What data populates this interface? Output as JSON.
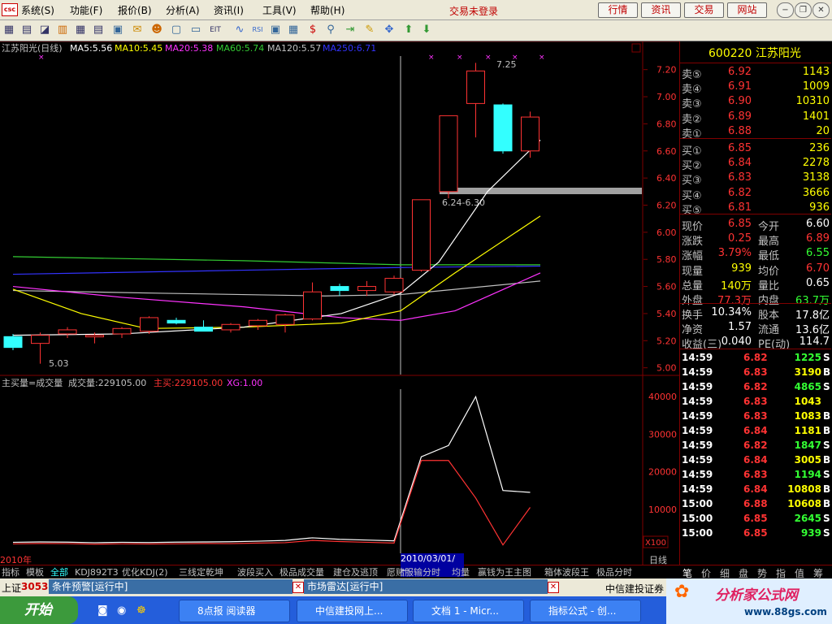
{
  "menubar": {
    "logo": "csc",
    "items": [
      "系统(S)",
      "功能(F)",
      "报价(B)",
      "分析(A)",
      "资讯(I)",
      "工具(V)",
      "帮助(H)"
    ],
    "login_status": "交易未登录",
    "buttons": [
      "行情",
      "资讯",
      "交易",
      "网站"
    ]
  },
  "chart": {
    "title_line": {
      "name": "江苏阳光(日线)",
      "ma5": "MA5:5.56",
      "ma10": "MA10:5.45",
      "ma20": "MA20:5.38",
      "ma60": "MA60:5.74",
      "ma120": "MA120:5.57",
      "ma250": "MA250:6.71"
    },
    "price_axis": [
      "7.20",
      "7.00",
      "6.80",
      "6.60",
      "6.40",
      "6.20",
      "6.00",
      "5.80",
      "5.60",
      "5.40",
      "5.20",
      "5.00"
    ],
    "annotations": {
      "high": "7.25",
      "low": "5.03",
      "gap": "6.24-6.30"
    },
    "volume_title": {
      "formula": "主买量=成交量",
      "volume": "成交量:229105.00",
      "buy": "主买:229105.00",
      "xg": "XG:1.00"
    },
    "volume_axis": [
      "40000",
      "30000",
      "20000",
      "10000"
    ],
    "volume_unit": "X100",
    "year_label": "2010年",
    "cursor_date": "2010/03/01/一",
    "period_label": "日线"
  },
  "chart_data": {
    "type": "candlestick",
    "x": [
      "c1",
      "c2",
      "c3",
      "c4",
      "c5",
      "c6",
      "c7",
      "c8",
      "c9",
      "c10",
      "c11",
      "c12",
      "c13",
      "c14",
      "c15",
      "c16",
      "c17",
      "c18",
      "c19",
      "c20"
    ],
    "ohlc": [
      [
        5.23,
        5.25,
        5.13,
        5.15
      ],
      [
        5.18,
        5.26,
        5.03,
        5.24
      ],
      [
        5.25,
        5.3,
        5.22,
        5.28
      ],
      [
        5.23,
        5.26,
        5.18,
        5.24
      ],
      [
        5.25,
        5.3,
        5.22,
        5.29
      ],
      [
        5.27,
        5.38,
        5.25,
        5.37
      ],
      [
        5.35,
        5.37,
        5.32,
        5.33
      ],
      [
        5.3,
        5.35,
        5.27,
        5.27
      ],
      [
        5.28,
        5.33,
        5.26,
        5.32
      ],
      [
        5.31,
        5.36,
        5.28,
        5.35
      ],
      [
        5.32,
        5.4,
        5.26,
        5.39
      ],
      [
        5.36,
        5.63,
        5.35,
        5.56
      ],
      [
        5.6,
        5.62,
        5.53,
        5.57
      ],
      [
        5.57,
        5.64,
        5.53,
        5.6
      ],
      [
        5.56,
        5.68,
        5.54,
        5.66
      ],
      [
        5.72,
        6.24,
        5.71,
        6.24
      ],
      [
        6.3,
        6.86,
        6.25,
        6.86
      ],
      [
        6.95,
        7.25,
        6.7,
        7.19
      ],
      [
        6.94,
        6.95,
        6.58,
        6.6
      ],
      [
        6.6,
        6.89,
        6.55,
        6.85
      ]
    ],
    "volume_main": [
      1200,
      1300,
      1250,
      1100,
      1200,
      1150,
      1250,
      1300,
      1350,
      1500,
      1700,
      2400,
      2000,
      1800,
      1600,
      24000,
      27000,
      40000,
      15000,
      14500
    ],
    "volume_buy": [
      800,
      900,
      850,
      700,
      800,
      750,
      800,
      900,
      850,
      1000,
      1100,
      1700,
      1400,
      1200,
      1000,
      23000,
      23000,
      13000,
      500,
      10500
    ],
    "ylim": [
      4.98,
      7.3
    ],
    "volume_ylim": [
      0,
      42000
    ],
    "ma_colors": {
      "ma5": "#ffffff",
      "ma10": "#ffff00",
      "ma20": "#ff33ff",
      "ma60": "#33cc33",
      "ma120": "#c0c0c0",
      "ma250": "#3333ff"
    }
  },
  "quote": {
    "code": "600220",
    "name": "江苏阳光",
    "asks": [
      {
        "label": "卖⑤",
        "price": "6.92",
        "vol": "1143"
      },
      {
        "label": "卖④",
        "price": "6.91",
        "vol": "1009"
      },
      {
        "label": "卖③",
        "price": "6.90",
        "vol": "10310"
      },
      {
        "label": "卖②",
        "price": "6.89",
        "vol": "1401"
      },
      {
        "label": "卖①",
        "price": "6.88",
        "vol": "20"
      }
    ],
    "bids": [
      {
        "label": "买①",
        "price": "6.85",
        "vol": "236"
      },
      {
        "label": "买②",
        "price": "6.84",
        "vol": "2278"
      },
      {
        "label": "买③",
        "price": "6.83",
        "vol": "3138"
      },
      {
        "label": "买④",
        "price": "6.82",
        "vol": "3666"
      },
      {
        "label": "买⑤",
        "price": "6.81",
        "vol": "936"
      }
    ],
    "stats1": [
      {
        "l1": "现价",
        "v1": "6.85",
        "c1": "red",
        "l2": "今开",
        "v2": "6.60",
        "c2": "white"
      },
      {
        "l1": "涨跌",
        "v1": "0.25",
        "c1": "red",
        "l2": "最高",
        "v2": "6.89",
        "c2": "red"
      },
      {
        "l1": "涨幅",
        "v1": "3.79%",
        "c1": "red",
        "l2": "最低",
        "v2": "6.55",
        "c2": "green"
      },
      {
        "l1": "现量",
        "v1": "939",
        "c1": "yellow",
        "l2": "均价",
        "v2": "6.70",
        "c2": "red"
      },
      {
        "l1": "总量",
        "v1": "140万",
        "c1": "yellow",
        "l2": "量比",
        "v2": "0.65",
        "c2": "white"
      },
      {
        "l1": "外盘",
        "v1": "77.3万",
        "c1": "red",
        "l2": "内盘",
        "v2": "63.7万",
        "c2": "green"
      }
    ],
    "stats2": [
      {
        "l1": "换手",
        "v1": "10.34%",
        "l2": "股本",
        "v2": "17.8亿"
      },
      {
        "l1": "净资",
        "v1": "1.57",
        "l2": "流通",
        "v2": "13.6亿"
      },
      {
        "l1": "收益(三)",
        "v1": "0.040",
        "l2": "PE(动)",
        "v2": "114.7"
      }
    ],
    "ticks": [
      {
        "time": "14:59",
        "price": "6.82",
        "vol": "1225",
        "flag": "S",
        "pc": "red"
      },
      {
        "time": "14:59",
        "price": "6.83",
        "vol": "3190",
        "flag": "B",
        "pc": "red"
      },
      {
        "time": "14:59",
        "price": "6.82",
        "vol": "4865",
        "flag": "S",
        "pc": "red"
      },
      {
        "time": "14:59",
        "price": "6.83",
        "vol": "1043",
        "flag": "",
        "pc": "red"
      },
      {
        "time": "14:59",
        "price": "6.83",
        "vol": "1083",
        "flag": "B",
        "pc": "red"
      },
      {
        "time": "14:59",
        "price": "6.84",
        "vol": "1181",
        "flag": "B",
        "pc": "red"
      },
      {
        "time": "14:59",
        "price": "6.82",
        "vol": "1847",
        "flag": "S",
        "pc": "red"
      },
      {
        "time": "14:59",
        "price": "6.84",
        "vol": "3005",
        "flag": "B",
        "pc": "red"
      },
      {
        "time": "14:59",
        "price": "6.83",
        "vol": "1194",
        "flag": "S",
        "pc": "red"
      },
      {
        "time": "14:59",
        "price": "6.84",
        "vol": "10808",
        "flag": "B",
        "pc": "red"
      },
      {
        "time": "15:00",
        "price": "6.88",
        "vol": "10608",
        "flag": "B",
        "pc": "red"
      },
      {
        "time": "15:00",
        "price": "6.85",
        "vol": "2645",
        "flag": "S",
        "pc": "red"
      },
      {
        "time": "15:00",
        "price": "6.85",
        "vol": "939",
        "flag": "S",
        "pc": "red"
      }
    ]
  },
  "tabs": [
    "指标",
    "模板",
    "全部",
    "KDJ892T3",
    "优化KDJ(2)",
    "三线定乾坤",
    "波段买入",
    "极品成交量",
    "建仓及逃顶",
    "愿赌服输分时",
    "均量",
    "赢钱为王主图",
    "箱体波段王",
    "极品分时"
  ],
  "right_tabs": [
    "笔",
    "价",
    "细",
    "盘",
    "势",
    "指",
    "值",
    "筹"
  ],
  "status": {
    "index_label": "上证",
    "index_value": "3053.",
    "alert": "条件预警[运行中]",
    "radar": "市场雷达[运行中]",
    "broker": "中信建投证券"
  },
  "taskbar": {
    "start": "开始",
    "tasks": [
      "8点报 阅读器",
      "中信建投网上...",
      "文档 1 - Micr...",
      "指标公式 - 创..."
    ],
    "promo_title": "分析家公式网",
    "promo_url": "www.88gs.com"
  }
}
